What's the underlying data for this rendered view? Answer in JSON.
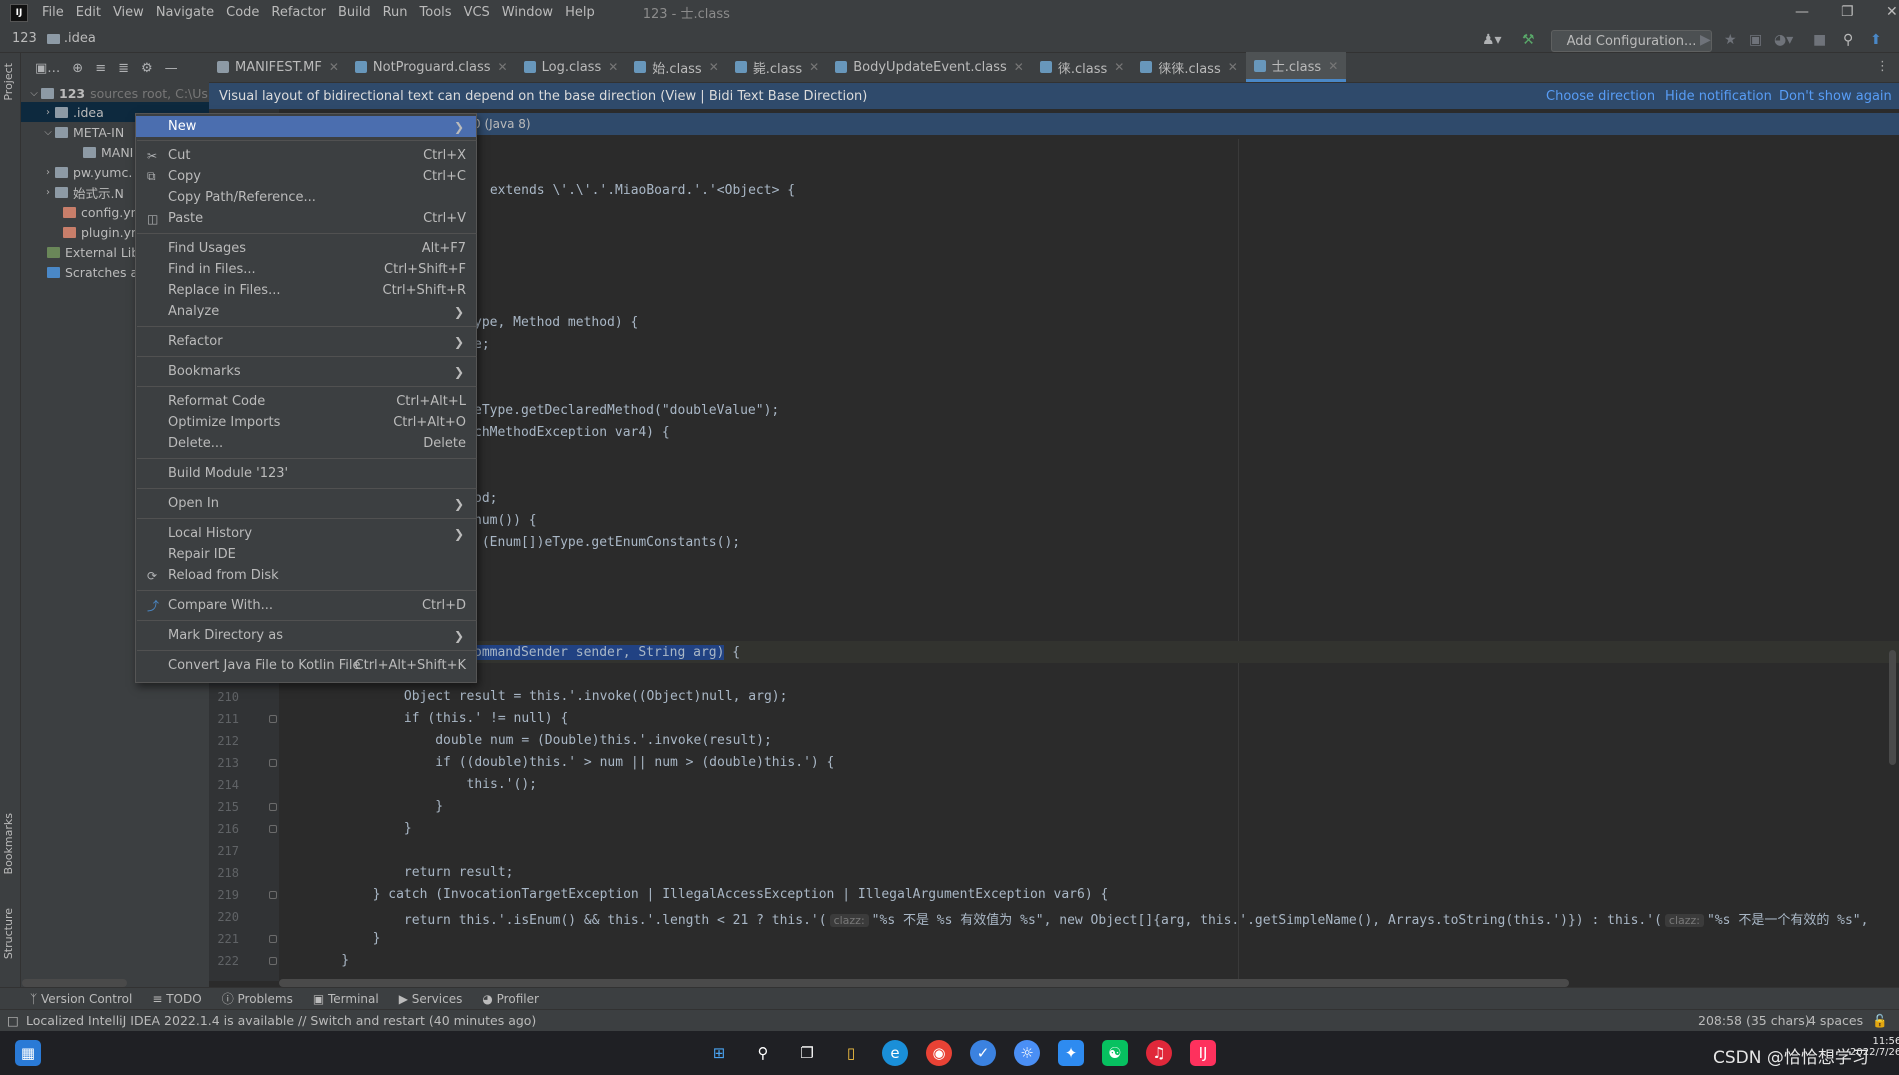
{
  "menubar": {
    "logo": "IJ",
    "items": [
      "File",
      "Edit",
      "View",
      "Navigate",
      "Code",
      "Refactor",
      "Build",
      "Run",
      "Tools",
      "VCS",
      "Window",
      "Help"
    ],
    "window_title": "123 - 士.class"
  },
  "navbar": {
    "project": "123",
    "folder": ".idea",
    "add_configuration": "Add Configuration..."
  },
  "left_strip": {
    "project": "Project",
    "bookmarks": "Bookmarks",
    "structure": "Structure"
  },
  "project_tree": {
    "root_name": "123",
    "root_suffix": "sources root,  C:\\Us",
    "items": [
      ".idea",
      "META-IN",
      "MANI",
      "pw.yumc.",
      "始式示.N",
      "config.yn",
      "plugin.yn",
      "External Libr",
      "Scratches ar"
    ]
  },
  "tabs": [
    "MANIFEST.MF",
    "NotProguard.class",
    "Log.class",
    "始.class",
    "毙.class",
    "徕.class",
    "BodyUpdateEvent.class",
    "徕.class",
    "徕徕.class",
    "士.class"
  ],
  "notification": {
    "text": "Visual layout of bidirectional text can depend on the base direction (View | Bidi Text Base Direction)",
    "choose": "Choose direction",
    "hide": "Hide notification",
    "dont_show": "Don't show again"
  },
  "context_menu": {
    "new": "New",
    "cut": "Cut",
    "cut_sc": "Ctrl+X",
    "copy": "Copy",
    "copy_sc": "Ctrl+C",
    "copy_path": "Copy Path/Reference...",
    "paste": "Paste",
    "paste_sc": "Ctrl+V",
    "find_usages": "Find Usages",
    "find_usages_sc": "Alt+F7",
    "find_in_files": "Find in Files...",
    "find_in_files_sc": "Ctrl+Shift+F",
    "replace_in_files": "Replace in Files...",
    "replace_in_files_sc": "Ctrl+Shift+R",
    "analyze": "Analyze",
    "refactor": "Refactor",
    "bookmarks": "Bookmarks",
    "reformat": "Reformat Code",
    "reformat_sc": "Ctrl+Alt+L",
    "optimize": "Optimize Imports",
    "optimize_sc": "Ctrl+Alt+O",
    "delete": "Delete...",
    "delete_sc": "Delete",
    "build_module": "Build Module '123'",
    "open_in": "Open In",
    "local_history": "Local History",
    "repair": "Repair IDE",
    "reload": "Reload from Disk",
    "compare": "Compare With...",
    "compare_sc": "Ctrl+D",
    "mark_dir": "Mark Directory as",
    "convert": "Convert Java File to Kotlin File",
    "convert_sc": "Ctrl+Alt+Shift+K"
  },
  "code": {
    "java_hint": "0 (Java 8)",
    "l1": " extends \\'.\\'.'.MiaoBoard.'.'<Object> {",
    "l2": "ype, Method method) {",
    "l3": "e;",
    "l4": "eType.getDeclaredMethod(\"doubleValue\");",
    "l5": "chMethodException var4) {",
    "l6": "od;",
    "l7": "num()) {",
    "l8": " (Enum[])eType.getEnumConstants();",
    "l9_sel": "ommandSender sender, String arg)",
    "l9_rest": " {",
    "rows": [
      {
        "n": "210",
        "t": "            Object result = this.'.invoke((Object)null, arg);"
      },
      {
        "n": "211",
        "t": "            if (this.' != null) {"
      },
      {
        "n": "212",
        "t": "                double num = (Double)this.'.invoke(result);"
      },
      {
        "n": "213",
        "t": "                if ((double)this.' > num || num > (double)this.') {"
      },
      {
        "n": "214",
        "t": "                    this.'();"
      },
      {
        "n": "215",
        "t": "                }"
      },
      {
        "n": "216",
        "t": "            }"
      },
      {
        "n": "217",
        "t": ""
      },
      {
        "n": "218",
        "t": "            return result;"
      },
      {
        "n": "219",
        "t": "        } catch (InvocationTargetException | IllegalAccessException | IllegalArgumentException var6) {"
      },
      {
        "n": "221",
        "t": "        }"
      },
      {
        "n": "222",
        "t": "    }"
      }
    ],
    "l220_a": "            return this.'.isEnum() && this.'.length < 21 ? this.'(",
    "l220_hint1": "clazz:",
    "l220_b": "\"%s 不是 %s 有效值为 %s\", new Object[]{arg, this.'.getSimpleName(), Arrays.toString(this.')}) : this.'(",
    "l220_hint2": "clazz:",
    "l220_c": "\"%s 不是一个有效的 %s\",",
    "n220": "220"
  },
  "bottom_tools": [
    "Version Control",
    "TODO",
    "Problems",
    "Terminal",
    "Services",
    "Profiler"
  ],
  "status": {
    "message": "Localized IntelliJ IDEA 2022.1.4 is available // Switch and restart (40 minutes ago)",
    "position": "208:58 (35 chars)",
    "indent": "4 spaces"
  },
  "taskbar": {
    "watermark": "CSDN @恰恰想学习",
    "time": "11:56",
    "date": "2022/7/26"
  },
  "colors": {
    "accent": "#4b6eaf",
    "notif_bg": "#2f4a6b",
    "link": "#589df6"
  }
}
